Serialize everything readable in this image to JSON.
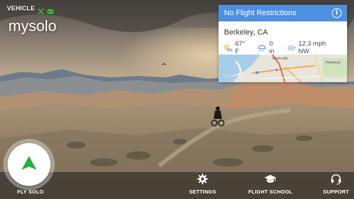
{
  "status": {
    "label": "VEHICLE",
    "icons": [
      "drone-icon",
      "controller-icon"
    ],
    "status_color": "#3ec83e",
    "vehicle_name": "mysolo"
  },
  "card": {
    "header": "No Flight Restrictions",
    "info_icon": "i",
    "city": "Berkeley, CA",
    "temperature": "67° F",
    "precipitation": "0 in",
    "wind": "12.3 mph NW",
    "map_labels": [
      "Emeryville",
      "Piedmont"
    ],
    "header_color": "#4d90e0"
  },
  "nav": {
    "fly_solo": "FLY SOLO",
    "settings": "SETTINGS",
    "flight_school": "FLIGHT SCHOOL",
    "support": "SUPPORT"
  },
  "colors": {
    "fly_arrow": "#22b03a",
    "accent": "#4d90e0"
  }
}
